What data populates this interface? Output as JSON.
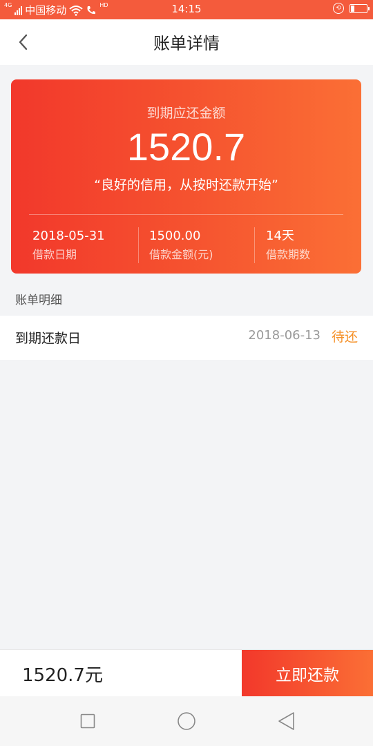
{
  "status_bar": {
    "network_type": "4G",
    "carrier": "中国移动",
    "hd_label": "HD",
    "time": "14:15"
  },
  "header": {
    "title": "账单详情"
  },
  "summary": {
    "label": "到期应还金额",
    "amount": "1520.7",
    "slogan": "“良好的信用，从按时还款开始”",
    "stats": [
      {
        "value": "2018-05-31",
        "label": "借款日期"
      },
      {
        "value": "1500.00",
        "label": "借款金额(元)"
      },
      {
        "value": "14天",
        "label": "借款期数"
      }
    ]
  },
  "details": {
    "section_title": "账单明细",
    "rows": [
      {
        "label": "到期还款日",
        "date": "2018-06-13",
        "status": "待还"
      }
    ]
  },
  "footer": {
    "total": "1520.7元",
    "pay_button": "立即还款"
  },
  "colors": {
    "accent_start": "#f2382b",
    "accent_end": "#fb6f35",
    "status_pending": "#f5922b",
    "background": "#f3f4f6"
  },
  "icons": [
    "signal-icon",
    "wifi-icon",
    "call-icon",
    "lock-rotation-icon",
    "battery-icon",
    "back-arrow-icon",
    "square-nav-icon",
    "circle-nav-icon",
    "triangle-nav-icon"
  ]
}
